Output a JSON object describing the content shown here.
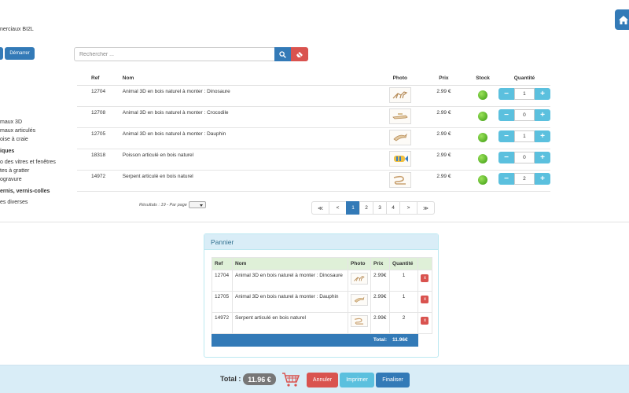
{
  "header": {
    "subtitle": "nerciaux BI2L",
    "home_icon": "home-icon"
  },
  "toolbar": {
    "start_label": "Démarrer",
    "search_placeholder": "Rechercher ..."
  },
  "categories": [
    {
      "label": "maux 3D",
      "bold": false
    },
    {
      "label": "maux articulés",
      "bold": false
    },
    {
      "label": "oise à craie",
      "bold": false
    },
    {
      "label": "iques",
      "bold": true
    },
    {
      "label": "o des vitres et fenêtres",
      "bold": false
    },
    {
      "label": "tes à gratter",
      "bold": false
    },
    {
      "label": "ogravure",
      "bold": false
    },
    {
      "label": "ernis, vernis-colles",
      "bold": true
    },
    {
      "label": "es diverses",
      "bold": false
    }
  ],
  "products": {
    "columns": {
      "ref": "Ref",
      "nom": "Nom",
      "photo": "Photo",
      "prix": "Prix",
      "stock": "Stock",
      "quantite": "Quantité"
    },
    "rows": [
      {
        "ref": "12704",
        "nom": "Animal 3D en bois naturel à monter : Dinosaure",
        "prix": "2.99 €",
        "qty": "1",
        "photo": "dinosaur"
      },
      {
        "ref": "12708",
        "nom": "Animal 3D en bois naturel à monter : Crocodile",
        "prix": "2.99 €",
        "qty": "0",
        "photo": "crocodile"
      },
      {
        "ref": "12705",
        "nom": "Animal 3D en bois naturel à monter : Dauphin",
        "prix": "2.99 €",
        "qty": "1",
        "photo": "dolphin"
      },
      {
        "ref": "18318",
        "nom": "Poisson articulé en bois naturel",
        "prix": "2.99 €",
        "qty": "0",
        "photo": "fish"
      },
      {
        "ref": "14972",
        "nom": "Serpent articulé en bois naturel",
        "prix": "2.99 €",
        "qty": "2",
        "photo": "snake"
      }
    ]
  },
  "results_text": "Résultats : 19 - Par page",
  "pagination": {
    "first": "≪",
    "prev": "<",
    "pages": [
      "1",
      "2",
      "3",
      "4"
    ],
    "active": "1",
    "next": ">",
    "last": "≫"
  },
  "cart": {
    "title": "Pannier",
    "columns": {
      "ref": "Ref",
      "nom": "Nom",
      "photo": "Photo",
      "prix": "Prix",
      "quantite": "Quantité"
    },
    "rows": [
      {
        "ref": "12704",
        "nom": "Animal 3D en bois naturel à monter : Dinosaure",
        "prix": "2.99€",
        "qty": "1",
        "photo": "dinosaur"
      },
      {
        "ref": "12705",
        "nom": "Animal 3D en bois naturel à monter : Dauphin",
        "prix": "2.99€",
        "qty": "1",
        "photo": "dolphin"
      },
      {
        "ref": "14972",
        "nom": "Serpent articulé en bois naturel",
        "prix": "2.99€",
        "qty": "2",
        "photo": "snake"
      }
    ],
    "delete_label": "x",
    "total_label": "Total:",
    "total_value": "11.96€"
  },
  "footer": {
    "total_label": "Total :",
    "total_value": "11.96 €",
    "cancel_label": "Annuler",
    "print_label": "Imprimer",
    "finish_label": "Finaliser"
  },
  "colors": {
    "primary": "#337ab7",
    "danger": "#d9534f",
    "info": "#5bc0de",
    "stock_ok": "#4cae1c"
  }
}
